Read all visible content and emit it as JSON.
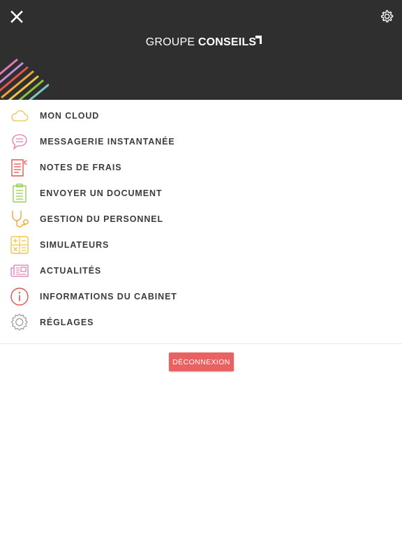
{
  "header": {
    "logo_light": "GROUPE",
    "logo_bold": "CONSEILS",
    "close_icon": "close-icon",
    "settings_icon": "gear-icon"
  },
  "menu": {
    "items": [
      {
        "label": "MON CLOUD",
        "icon": "cloud-icon",
        "color": "#f2c34b"
      },
      {
        "label": "MESSAGERIE INSTANTANÉE",
        "icon": "chat-bubble-icon",
        "color": "#e279b6"
      },
      {
        "label": "NOTES DE FRAIS",
        "icon": "expense-note-icon",
        "color": "#e5534f"
      },
      {
        "label": "ENVOYER UN DOCUMENT",
        "icon": "clipboard-icon",
        "color": "#8cc63f"
      },
      {
        "label": "GESTION DU PERSONNEL",
        "icon": "stethoscope-icon",
        "color": "#f0a73a"
      },
      {
        "label": "SIMULATEURS",
        "icon": "calculator-icon",
        "color": "#f2c34b"
      },
      {
        "label": "ACTUALITÉS",
        "icon": "newspaper-icon",
        "color": "#e279b6"
      },
      {
        "label": "INFORMATIONS DU CABINET",
        "icon": "info-icon",
        "color": "#e5534f"
      },
      {
        "label": "RÉGLAGES",
        "icon": "gear-icon",
        "color": "#9a9a9a"
      }
    ]
  },
  "logout": {
    "label": "DÉCONNEXION",
    "color": "#e96262"
  }
}
